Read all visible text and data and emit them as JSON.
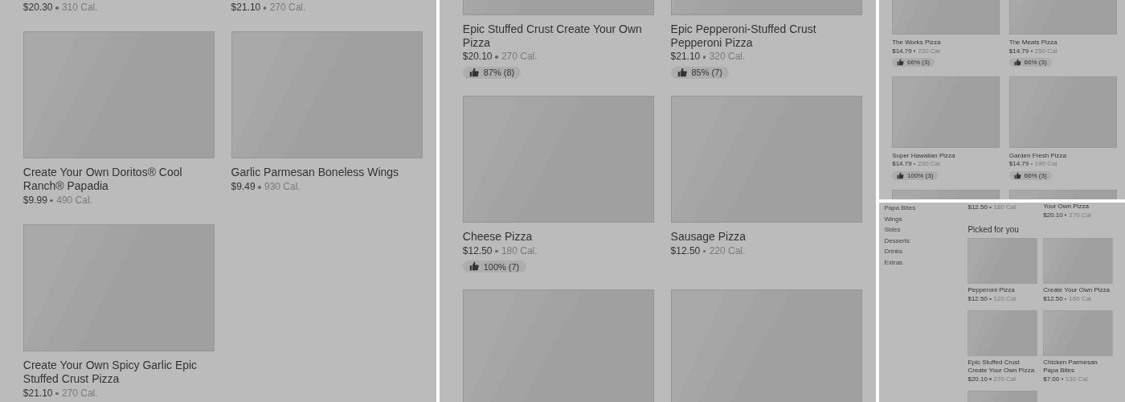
{
  "panels": [
    {
      "kind": "grid",
      "items": [
        {
          "price": "$20.30",
          "calories": "310 Cal."
        },
        {
          "price": "$21.10",
          "calories": "270 Cal."
        },
        {
          "image": true,
          "name": "Create Your Own Doritos® Cool Ranch® Papadia",
          "price": "$9.99",
          "calories": "490 Cal."
        },
        {
          "image": true,
          "name": "Garlic Parmesan Boneless Wings",
          "price": "$9.49",
          "calories": "930 Cal."
        },
        {
          "image": true,
          "name": "Create Your Own Spicy Garlic Epic Stuffed Crust Pizza",
          "price": "$21.10",
          "calories": "270 Cal."
        }
      ]
    },
    {
      "kind": "grid",
      "items": [
        {
          "image": true,
          "name": "Epic Stuffed Crust Create Your Own Pizza",
          "price": "$20.10",
          "calories": "270 Cal.",
          "rating": "87% (8)"
        },
        {
          "image": true,
          "name": "Epic Pepperoni-Stuffed Crust Pepperoni Pizza",
          "price": "$21.10",
          "calories": "320 Cal.",
          "rating": "85% (7)"
        },
        {
          "image": true,
          "name": "Cheese Pizza",
          "price": "$12.50",
          "calories": "180 Cal.",
          "rating": "100% (7)"
        },
        {
          "image": true,
          "name": "Sausage Pizza",
          "price": "$12.50",
          "calories": "220 Cal."
        },
        {
          "image": true
        },
        {
          "image": true
        }
      ]
    },
    {
      "kind": "grid",
      "items": [
        {
          "image": true,
          "name": "The Works Pizza",
          "price": "$14.79",
          "calories": "230 Cal",
          "rating": "66% (3)"
        },
        {
          "image": true,
          "name": "The Meats Pizza",
          "price": "$14.79",
          "calories": "250 Cal",
          "rating": "66% (3)"
        },
        {
          "image": true,
          "name": "Super Hawaiian Pizza",
          "price": "$14.79",
          "calories": "230 Cal",
          "rating": "100% (3)"
        },
        {
          "image": true,
          "name": "Garden Fresh Pizza",
          "price": "$14.79",
          "calories": "190 Cal",
          "rating": "66% (3)"
        },
        {
          "image": true
        },
        {
          "image": true
        }
      ]
    },
    {
      "kind": "menu",
      "sidebar": [
        {
          "label": "Papa Bites"
        },
        {
          "label": "Wings"
        },
        {
          "label": "Sides"
        },
        {
          "label": "Desserts"
        },
        {
          "label": "Drinks"
        },
        {
          "label": "Extras"
        }
      ],
      "top_items": [
        {
          "price": "$12.50",
          "calories": "180 Cal"
        },
        {
          "name": "Your Own Pizza",
          "price": "$20.10",
          "calories": "270 Cal"
        }
      ],
      "section_title": "Picked for you",
      "items": [
        {
          "image": true,
          "name": "Pepperoni Pizza",
          "price": "$12.50",
          "calories": "120 Cal"
        },
        {
          "image": true,
          "name": "Create Your Own Pizza",
          "price": "$12.50",
          "calories": "160 Cal"
        },
        {
          "image": true,
          "name": "Epic Stuffed Crust Create Your Own Pizza",
          "price": "$20.10",
          "calories": "270 Cal"
        },
        {
          "image": true,
          "name": "Chicken Parmesan Papa Bites",
          "price": "$7.00",
          "calories": "130 Cal"
        },
        {
          "image": true
        }
      ]
    }
  ]
}
